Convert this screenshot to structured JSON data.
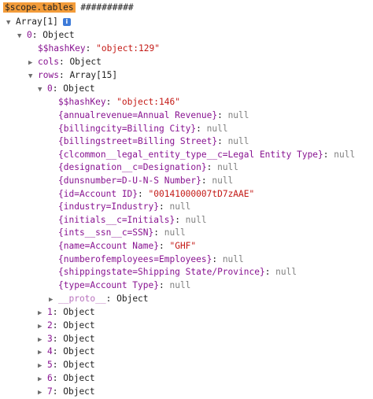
{
  "header": {
    "expression": "$scope.tables",
    "suffix": "##########"
  },
  "root": {
    "label": "Array[1]",
    "info_icon": "i"
  },
  "item0": {
    "key": "0",
    "value": "Object",
    "hashkey_key": "$$hashKey",
    "hashkey_value": "\"object:129\"",
    "cols_key": "cols",
    "cols_value": "Object",
    "rows_key": "rows",
    "rows_value": "Array[15]"
  },
  "row0": {
    "key": "0",
    "value": "Object",
    "hashkey_key": "$$hashKey",
    "hashkey_value": "\"object:146\"",
    "fields": [
      {
        "key": "{annualrevenue=Annual Revenue}",
        "value": "null",
        "kind": "null"
      },
      {
        "key": "{billingcity=Billing City}",
        "value": "null",
        "kind": "null"
      },
      {
        "key": "{billingstreet=Billing Street}",
        "value": "null",
        "kind": "null"
      },
      {
        "key": "{clcommon__legal_entity_type__c=Legal Entity Type}",
        "value": "null",
        "kind": "null"
      },
      {
        "key": "{designation__c=Designation}",
        "value": "null",
        "kind": "null"
      },
      {
        "key": "{dunsnumber=D-U-N-S Number}",
        "value": "null",
        "kind": "null"
      },
      {
        "key": "{id=Account ID}",
        "value": "\"00141000007tD7zAAE\"",
        "kind": "str"
      },
      {
        "key": "{industry=Industry}",
        "value": "null",
        "kind": "null"
      },
      {
        "key": "{initials__c=Initials}",
        "value": "null",
        "kind": "null"
      },
      {
        "key": "{ints__ssn__c=SSN}",
        "value": "null",
        "kind": "null"
      },
      {
        "key": "{name=Account Name}",
        "value": "\"GHF\"",
        "kind": "str"
      },
      {
        "key": "{numberofemployees=Employees}",
        "value": "null",
        "kind": "null"
      },
      {
        "key": "{shippingstate=Shipping State/Province}",
        "value": "null",
        "kind": "null"
      },
      {
        "key": "{type=Account Type}",
        "value": "null",
        "kind": "null"
      }
    ],
    "proto_key": "__proto__",
    "proto_value": "Object"
  },
  "collapsed_rows": [
    {
      "key": "1",
      "value": "Object"
    },
    {
      "key": "2",
      "value": "Object"
    },
    {
      "key": "3",
      "value": "Object"
    },
    {
      "key": "4",
      "value": "Object"
    },
    {
      "key": "5",
      "value": "Object"
    },
    {
      "key": "6",
      "value": "Object"
    },
    {
      "key": "7",
      "value": "Object"
    }
  ],
  "colors": {
    "highlight": "#f39c3a",
    "property_key": "#881391",
    "string_value": "#c41a16",
    "null_value": "#808080",
    "info_badge": "#3d7bd9"
  },
  "icons": {
    "expanded": "triangle-down-icon",
    "collapsed": "triangle-right-icon",
    "info": "info-icon"
  }
}
